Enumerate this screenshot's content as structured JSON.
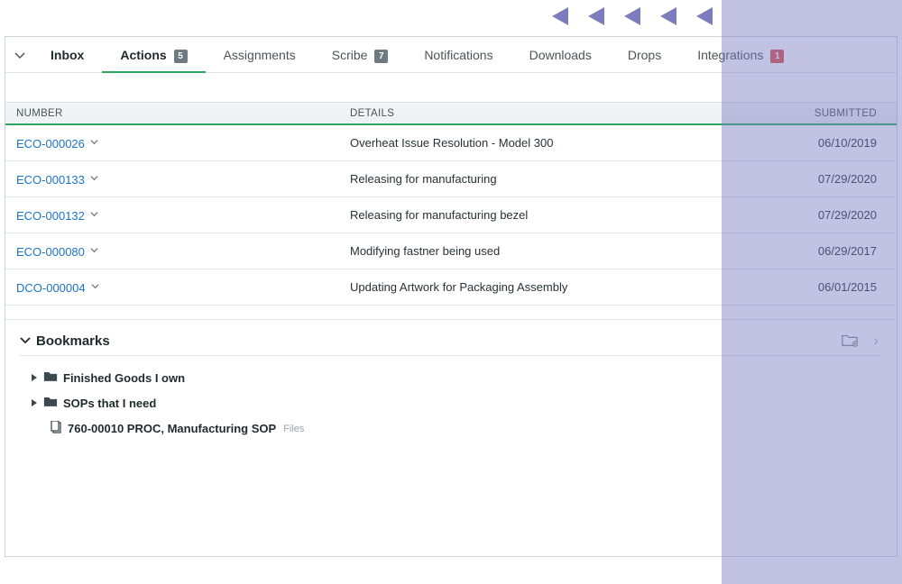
{
  "tabs": {
    "inbox": "Inbox",
    "actions": "Actions",
    "actions_badge": "5",
    "assignments": "Assignments",
    "scribe": "Scribe",
    "scribe_badge": "7",
    "notifications": "Notifications",
    "downloads": "Downloads",
    "drops": "Drops",
    "integrations": "Integrations",
    "integrations_badge": "1"
  },
  "table": {
    "headers": {
      "number": "NUMBER",
      "details": "DETAILS",
      "submitted": "SUBMITTED"
    },
    "rows": [
      {
        "number": "ECO-000026",
        "details": "Overheat Issue Resolution - Model 300",
        "submitted": "06/10/2019"
      },
      {
        "number": "ECO-000133",
        "details": "Releasing for manufacturing",
        "submitted": "07/29/2020"
      },
      {
        "number": "ECO-000132",
        "details": "Releasing for manufacturing bezel",
        "submitted": "07/29/2020"
      },
      {
        "number": "ECO-000080",
        "details": "Modifying fastner being used",
        "submitted": "06/29/2017"
      },
      {
        "number": "DCO-000004",
        "details": "Updating Artwork for Packaging Assembly",
        "submitted": "06/01/2015"
      }
    ]
  },
  "bookmarks": {
    "title": "Bookmarks",
    "items": [
      {
        "type": "folder",
        "label": "Finished Goods I own"
      },
      {
        "type": "folder",
        "label": "SOPs that I need"
      },
      {
        "type": "doc",
        "label": "760-00010 PROC, Manufacturing SOP",
        "suffix": "Files"
      }
    ]
  }
}
